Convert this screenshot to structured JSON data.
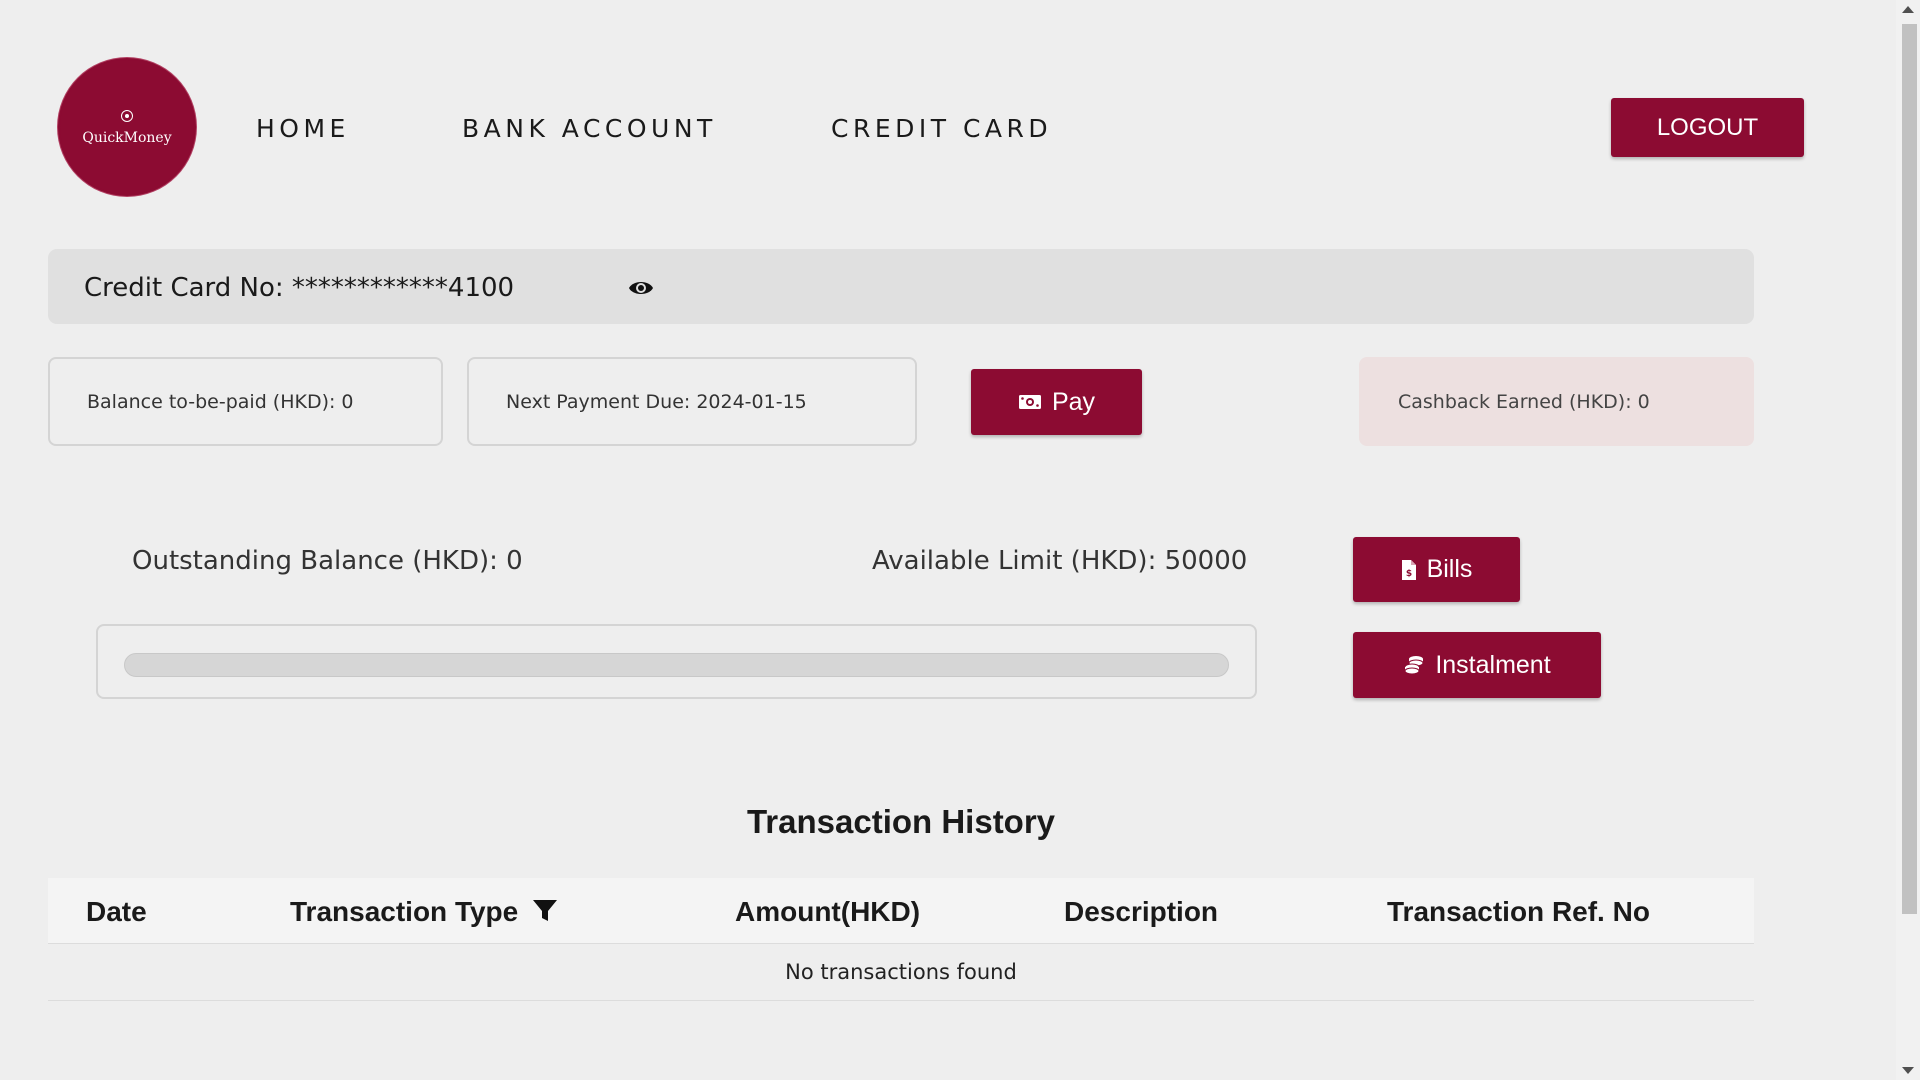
{
  "brand": {
    "name": "QuickMoney",
    "color": "#8c0b32"
  },
  "nav": {
    "items": [
      {
        "label": "HOME"
      },
      {
        "label": "BANK ACCOUNT"
      },
      {
        "label": "CREDIT CARD"
      }
    ],
    "logout_label": "LOGOUT"
  },
  "card": {
    "label": "Credit Card No: ************4100",
    "toggle_icon": "eye-icon"
  },
  "summary": {
    "balance_to_be_paid": "Balance to-be-paid (HKD): 0",
    "next_payment_due": "Next Payment Due: 2024-01-15",
    "pay_label": "Pay",
    "pay_icon": "money-bill-icon",
    "cashback": "Cashback Earned (HKD): 0"
  },
  "limits": {
    "outstanding": "Outstanding Balance (HKD): 0",
    "available": "Available Limit (HKD): 50000",
    "usage_fraction": 0
  },
  "actions": {
    "bills_label": "Bills",
    "bills_icon": "file-invoice-dollar-icon",
    "instalment_label": "Instalment",
    "instalment_icon": "coins-icon"
  },
  "transactions": {
    "title": "Transaction History",
    "columns": [
      "Date",
      "Transaction Type",
      "Amount(HKD)",
      "Description",
      "Transaction Ref. No"
    ],
    "filter_icon": "filter-icon",
    "empty_message": "No transactions found",
    "rows": []
  }
}
